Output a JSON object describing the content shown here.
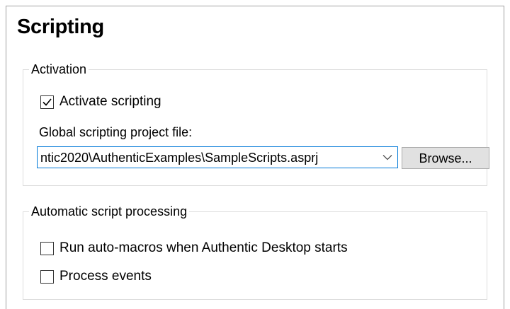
{
  "page": {
    "title": "Scripting"
  },
  "activation": {
    "group_title": "Activation",
    "activate_checkbox": {
      "label": "Activate scripting",
      "checked": true
    },
    "project_file_label": "Global scripting project file:",
    "project_file_value": "ntic2020\\AuthenticExamples\\SampleScripts.asprj",
    "browse_label": "Browse..."
  },
  "auto_processing": {
    "group_title": "Automatic script processing",
    "run_auto_macros": {
      "label": "Run auto-macros when Authentic Desktop starts",
      "checked": false
    },
    "process_events": {
      "label": "Process events",
      "checked": false
    }
  },
  "colors": {
    "focus_border": "#0078d7",
    "button_face": "#e1e1e1",
    "group_border": "#dcdcdc"
  }
}
